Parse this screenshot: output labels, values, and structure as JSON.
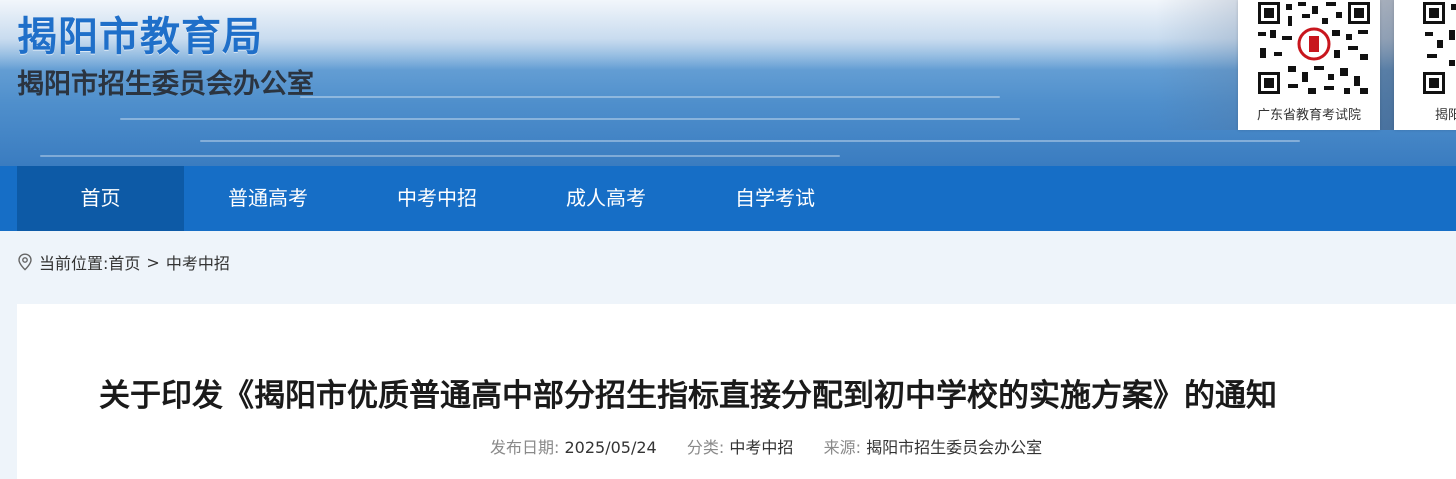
{
  "header": {
    "site_title": "揭阳市教育局",
    "site_subtitle": "揭阳市招生委员会办公室",
    "qr_codes": [
      {
        "label": "广东省教育考试院"
      },
      {
        "label": "揭阳"
      }
    ]
  },
  "nav": {
    "items": [
      {
        "label": "首页",
        "active": true
      },
      {
        "label": "普通高考"
      },
      {
        "label": "中考中招"
      },
      {
        "label": "成人高考"
      },
      {
        "label": "自学考试"
      }
    ]
  },
  "breadcrumb": {
    "prefix": "当前位置:",
    "home": "首页",
    "separator": ">",
    "current": "中考中招"
  },
  "article": {
    "title": "关于印发《揭阳市优质普通高中部分招生指标直接分配到初中学校的实施方案》的通知",
    "meta": {
      "date_label": "发布日期:",
      "date": "2025/05/24",
      "category_label": "分类:",
      "category": "中考中招",
      "source_label": "来源:",
      "source": "揭阳市招生委员会办公室"
    }
  },
  "colors": {
    "brand_blue": "#1f6fc9",
    "nav_bg": "#166ec6",
    "nav_active": "#0d5aa6",
    "page_bg": "#eef4fa"
  }
}
